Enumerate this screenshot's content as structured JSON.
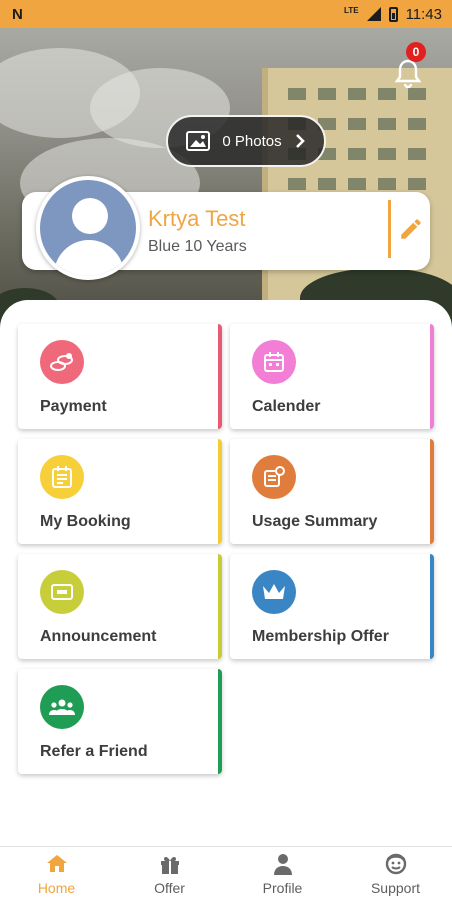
{
  "status_bar": {
    "carrier_icon": "N",
    "network": "LTE",
    "time": "11:43"
  },
  "notifications": {
    "count": "0",
    "icon": "bell-icon"
  },
  "photos": {
    "label": "0 Photos",
    "icon": "image-icon"
  },
  "profile": {
    "name": "Krtya Test",
    "tier": "Blue 10 Years",
    "avatar_icon": "user-avatar-icon",
    "edit_icon": "pencil-icon"
  },
  "tiles": [
    {
      "label": "Payment",
      "icon": "coins-icon",
      "icon_color": "#f0697a",
      "stripe_color": "#e85a73"
    },
    {
      "label": "Calender",
      "icon": "calendar-icon",
      "icon_color": "#f37ed6",
      "stripe_color": "#ef7fd6"
    },
    {
      "label": "My Booking",
      "icon": "booking-icon",
      "icon_color": "#f7cf38",
      "stripe_color": "#f3cb32"
    },
    {
      "label": "Usage Summary",
      "icon": "usage-summary-icon",
      "icon_color": "#e07d3d",
      "stripe_color": "#e07d3d"
    },
    {
      "label": "Announcement",
      "icon": "announcement-icon",
      "icon_color": "#c7ce3a",
      "stripe_color": "#c6cc34"
    },
    {
      "label": "Membership Offer",
      "icon": "crown-icon",
      "icon_color": "#3a86c5",
      "stripe_color": "#3a86c5"
    },
    {
      "label": "Refer a Friend",
      "icon": "group-icon",
      "icon_color": "#1f9d55",
      "stripe_color": "#1f9d55"
    }
  ],
  "bottom_nav": [
    {
      "label": "Home",
      "icon": "home-icon",
      "active": true
    },
    {
      "label": "Offer",
      "icon": "gift-icon",
      "active": false
    },
    {
      "label": "Profile",
      "icon": "person-icon",
      "active": false
    },
    {
      "label": "Support",
      "icon": "support-icon",
      "active": false
    }
  ],
  "colors": {
    "accent": "#f0a541",
    "badge": "#e0211f",
    "text_dark": "#3d3d3d"
  }
}
